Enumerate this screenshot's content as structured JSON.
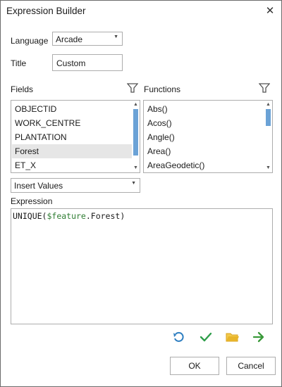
{
  "window": {
    "title": "Expression Builder"
  },
  "language": {
    "label": "Language",
    "value": "Arcade"
  },
  "title_field": {
    "label": "Title",
    "value": "Custom"
  },
  "fields": {
    "label": "Fields",
    "items": [
      "OBJECTID",
      "WORK_CENTRE",
      "PLANTATION",
      "Forest",
      "ET_X"
    ],
    "selected_index": 3
  },
  "functions": {
    "label": "Functions",
    "items": [
      "Abs()",
      "Acos()",
      "Angle()",
      "Area()",
      "AreaGeodetic()"
    ]
  },
  "insert_values": {
    "value": "Insert Values"
  },
  "expression": {
    "label": "Expression",
    "fn": "UNIQUE(",
    "var": "$feature",
    "rest": ".Forest)"
  },
  "icons": {
    "undo": "undo-icon",
    "verify": "checkmark-icon",
    "open": "folder-icon",
    "save": "arrow-right-icon"
  },
  "buttons": {
    "ok": "OK",
    "cancel": "Cancel"
  },
  "colors": {
    "scroll_thumb": "#6ba2d6",
    "verify_green": "#2e9e4a",
    "folder_yellow": "#e8b52a",
    "arrow_green": "#3a9a3a",
    "undo_blue": "#2f7fc1"
  }
}
